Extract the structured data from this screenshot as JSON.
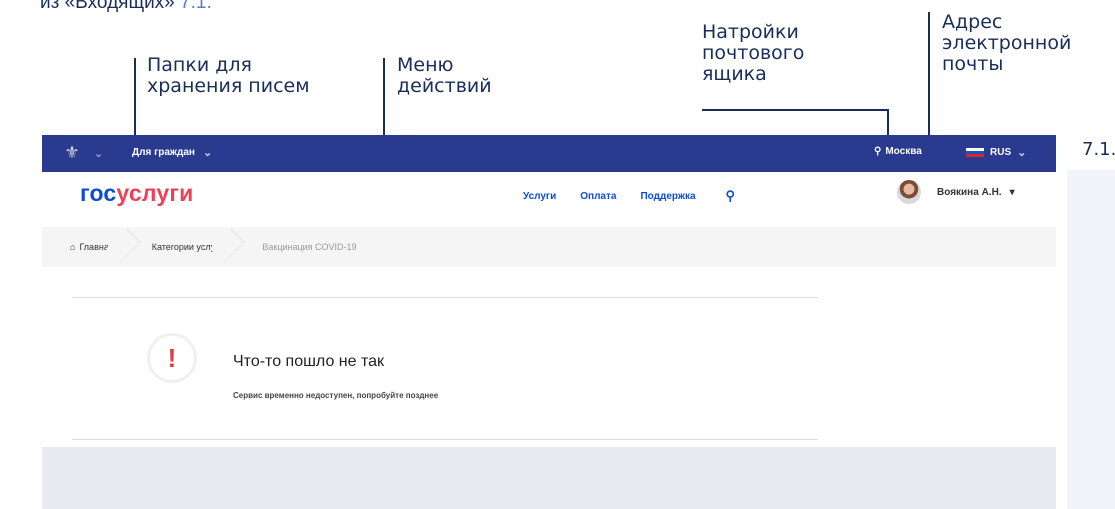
{
  "caption_top": {
    "text": "из «Входящих» ",
    "ref": "7.1."
  },
  "callouts": {
    "folders": "Папки для\nхранения писем",
    "actions": "Меню\nдействий",
    "settings": "Натройки\nпочтового\nящика",
    "address": "Адрес\nэлектронной\nпочты"
  },
  "figure_label": "7.1.",
  "topbar": {
    "citizens": "Для граждан",
    "location": "Москва",
    "lang": "RUS"
  },
  "navbar": {
    "logo_part1": "гос",
    "logo_part2": "услуги",
    "links": [
      "Услуги",
      "Оплата",
      "Поддержка"
    ],
    "user": "Воякина А.Н."
  },
  "breadcrumbs": [
    "Главная",
    "Категории услуг",
    "Вакцинация COVID-19"
  ],
  "error": {
    "title": "Что-то пошло не так",
    "text": "Сервис временно недоступен, попробуйте позднее"
  },
  "colors": {
    "topbar": "#2a3b8f",
    "logo_blue": "#0d4cd3",
    "logo_red": "#ee3f58",
    "error": "#e23b3b",
    "annotation": "#1a2d5a"
  }
}
